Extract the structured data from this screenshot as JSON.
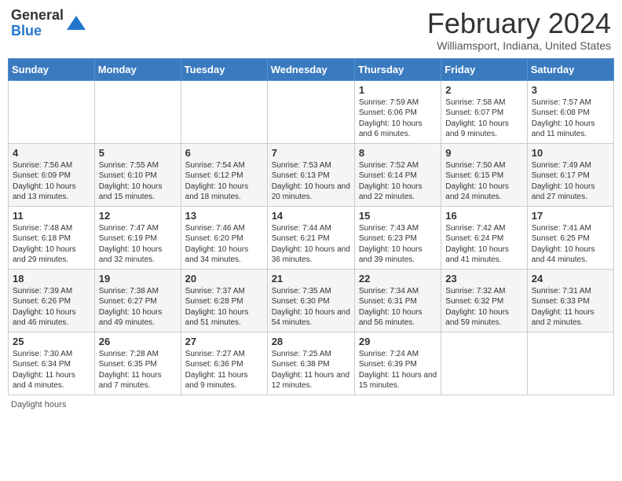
{
  "header": {
    "logo_general": "General",
    "logo_blue": "Blue",
    "title": "February 2024",
    "subtitle": "Williamsport, Indiana, United States"
  },
  "days_of_week": [
    "Sunday",
    "Monday",
    "Tuesday",
    "Wednesday",
    "Thursday",
    "Friday",
    "Saturday"
  ],
  "weeks": [
    [
      {
        "day": "",
        "info": ""
      },
      {
        "day": "",
        "info": ""
      },
      {
        "day": "",
        "info": ""
      },
      {
        "day": "",
        "info": ""
      },
      {
        "day": "1",
        "info": "Sunrise: 7:59 AM\nSunset: 6:06 PM\nDaylight: 10 hours\nand 6 minutes."
      },
      {
        "day": "2",
        "info": "Sunrise: 7:58 AM\nSunset: 6:07 PM\nDaylight: 10 hours\nand 9 minutes."
      },
      {
        "day": "3",
        "info": "Sunrise: 7:57 AM\nSunset: 6:08 PM\nDaylight: 10 hours\nand 11 minutes."
      }
    ],
    [
      {
        "day": "4",
        "info": "Sunrise: 7:56 AM\nSunset: 6:09 PM\nDaylight: 10 hours\nand 13 minutes."
      },
      {
        "day": "5",
        "info": "Sunrise: 7:55 AM\nSunset: 6:10 PM\nDaylight: 10 hours\nand 15 minutes."
      },
      {
        "day": "6",
        "info": "Sunrise: 7:54 AM\nSunset: 6:12 PM\nDaylight: 10 hours\nand 18 minutes."
      },
      {
        "day": "7",
        "info": "Sunrise: 7:53 AM\nSunset: 6:13 PM\nDaylight: 10 hours\nand 20 minutes."
      },
      {
        "day": "8",
        "info": "Sunrise: 7:52 AM\nSunset: 6:14 PM\nDaylight: 10 hours\nand 22 minutes."
      },
      {
        "day": "9",
        "info": "Sunrise: 7:50 AM\nSunset: 6:15 PM\nDaylight: 10 hours\nand 24 minutes."
      },
      {
        "day": "10",
        "info": "Sunrise: 7:49 AM\nSunset: 6:17 PM\nDaylight: 10 hours\nand 27 minutes."
      }
    ],
    [
      {
        "day": "11",
        "info": "Sunrise: 7:48 AM\nSunset: 6:18 PM\nDaylight: 10 hours\nand 29 minutes."
      },
      {
        "day": "12",
        "info": "Sunrise: 7:47 AM\nSunset: 6:19 PM\nDaylight: 10 hours\nand 32 minutes."
      },
      {
        "day": "13",
        "info": "Sunrise: 7:46 AM\nSunset: 6:20 PM\nDaylight: 10 hours\nand 34 minutes."
      },
      {
        "day": "14",
        "info": "Sunrise: 7:44 AM\nSunset: 6:21 PM\nDaylight: 10 hours\nand 36 minutes."
      },
      {
        "day": "15",
        "info": "Sunrise: 7:43 AM\nSunset: 6:23 PM\nDaylight: 10 hours\nand 39 minutes."
      },
      {
        "day": "16",
        "info": "Sunrise: 7:42 AM\nSunset: 6:24 PM\nDaylight: 10 hours\nand 41 minutes."
      },
      {
        "day": "17",
        "info": "Sunrise: 7:41 AM\nSunset: 6:25 PM\nDaylight: 10 hours\nand 44 minutes."
      }
    ],
    [
      {
        "day": "18",
        "info": "Sunrise: 7:39 AM\nSunset: 6:26 PM\nDaylight: 10 hours\nand 46 minutes."
      },
      {
        "day": "19",
        "info": "Sunrise: 7:38 AM\nSunset: 6:27 PM\nDaylight: 10 hours\nand 49 minutes."
      },
      {
        "day": "20",
        "info": "Sunrise: 7:37 AM\nSunset: 6:28 PM\nDaylight: 10 hours\nand 51 minutes."
      },
      {
        "day": "21",
        "info": "Sunrise: 7:35 AM\nSunset: 6:30 PM\nDaylight: 10 hours\nand 54 minutes."
      },
      {
        "day": "22",
        "info": "Sunrise: 7:34 AM\nSunset: 6:31 PM\nDaylight: 10 hours\nand 56 minutes."
      },
      {
        "day": "23",
        "info": "Sunrise: 7:32 AM\nSunset: 6:32 PM\nDaylight: 10 hours\nand 59 minutes."
      },
      {
        "day": "24",
        "info": "Sunrise: 7:31 AM\nSunset: 6:33 PM\nDaylight: 11 hours\nand 2 minutes."
      }
    ],
    [
      {
        "day": "25",
        "info": "Sunrise: 7:30 AM\nSunset: 6:34 PM\nDaylight: 11 hours\nand 4 minutes."
      },
      {
        "day": "26",
        "info": "Sunrise: 7:28 AM\nSunset: 6:35 PM\nDaylight: 11 hours\nand 7 minutes."
      },
      {
        "day": "27",
        "info": "Sunrise: 7:27 AM\nSunset: 6:36 PM\nDaylight: 11 hours\nand 9 minutes."
      },
      {
        "day": "28",
        "info": "Sunrise: 7:25 AM\nSunset: 6:38 PM\nDaylight: 11 hours\nand 12 minutes."
      },
      {
        "day": "29",
        "info": "Sunrise: 7:24 AM\nSunset: 6:39 PM\nDaylight: 11 hours\nand 15 minutes."
      },
      {
        "day": "",
        "info": ""
      },
      {
        "day": "",
        "info": ""
      }
    ]
  ],
  "footer": {
    "daylight_label": "Daylight hours"
  }
}
